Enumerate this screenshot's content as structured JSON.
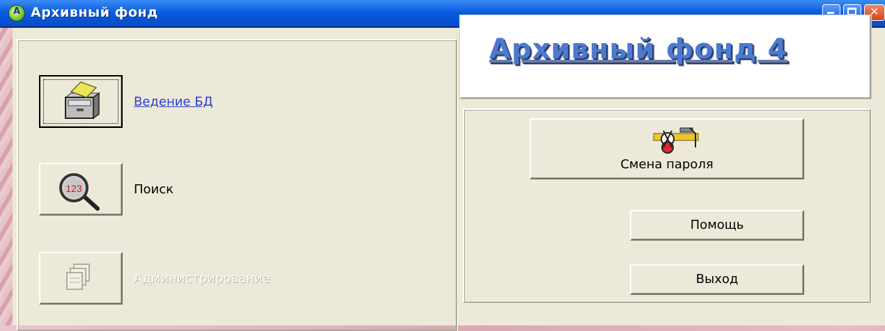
{
  "window": {
    "title": "Архивный фонд",
    "icon_letter": "А"
  },
  "banner": {
    "text": "Архивный фонд 4"
  },
  "left_menu": {
    "database": {
      "label": "Ведение БД",
      "icon": "filing-cabinet-icon",
      "state": "focused"
    },
    "search": {
      "label": "Поиск",
      "icon": "magnifier-123-icon",
      "state": "normal"
    },
    "admin": {
      "label": "Администрирование",
      "icon": "stacked-documents-icon",
      "state": "disabled"
    }
  },
  "right_buttons": {
    "change_password": {
      "label": "Смена пароля",
      "icon": "password-tools-icon"
    },
    "help": {
      "label": "Помощь"
    },
    "exit": {
      "label": "Выход"
    }
  },
  "colors": {
    "titlebar": "#0a5ee0",
    "window_bg": "#ece9d8",
    "link": "#2a3fd1",
    "banner_text": "#4b7ad0"
  }
}
